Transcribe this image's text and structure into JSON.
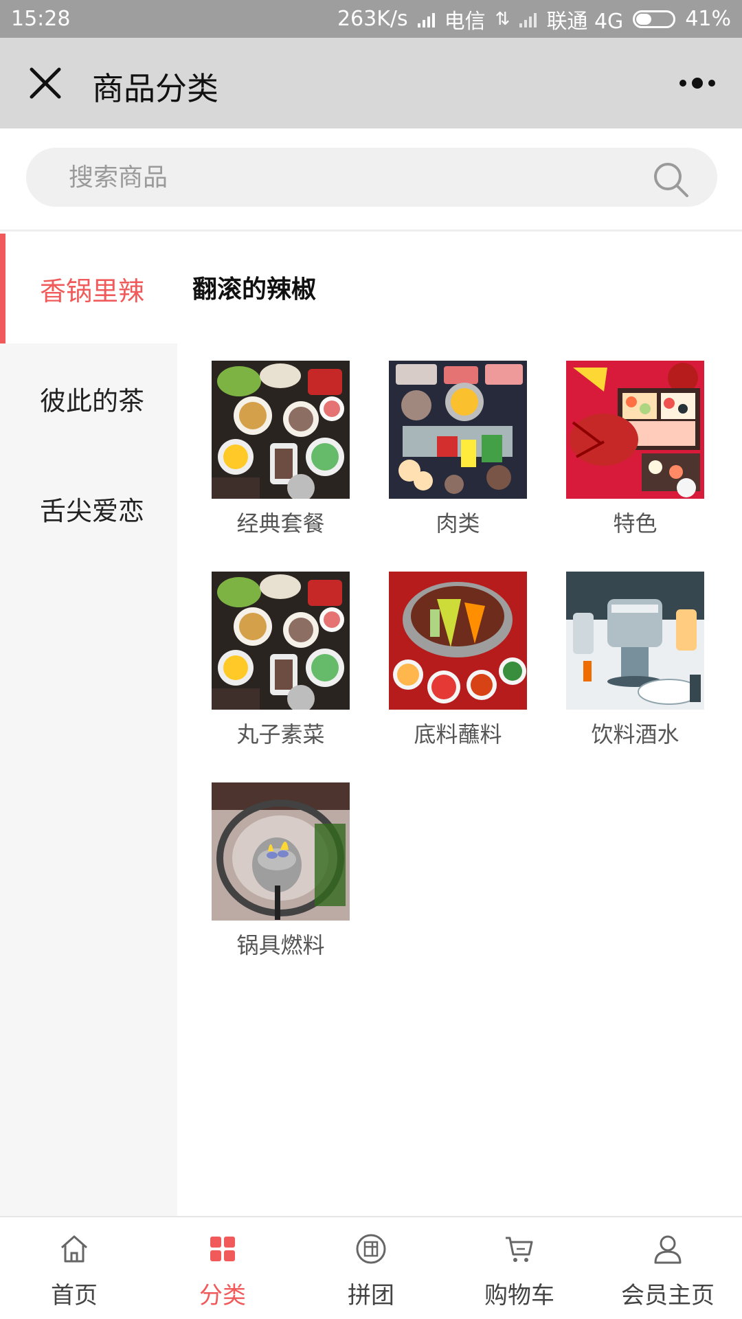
{
  "status_bar": {
    "time": "15:28",
    "speed": "263K/s",
    "carrier1": "电信",
    "carrier2": "联通 4G",
    "battery": "41%",
    "battery_level": 0.41
  },
  "header": {
    "title": "商品分类",
    "close_icon": "close-icon",
    "more_icon": "more-dots-icon"
  },
  "search": {
    "placeholder": "搜索商品",
    "value": "",
    "icon": "search-icon"
  },
  "sidebar": {
    "items": [
      {
        "label": "香锅里辣",
        "active": true
      },
      {
        "label": "彼此的茶",
        "active": false
      },
      {
        "label": "舌尖爱恋",
        "active": false
      }
    ]
  },
  "content": {
    "section_title": "翻滚的辣椒",
    "categories": [
      {
        "label": "经典套餐",
        "image": "hotpot-spread-photo"
      },
      {
        "label": "肉类",
        "image": "meat-platter-photo"
      },
      {
        "label": "特色",
        "image": "lobster-bento-photo"
      },
      {
        "label": "丸子素菜",
        "image": "hotpot-spread-photo"
      },
      {
        "label": "底料蘸料",
        "image": "hotpot-broth-sauces-photo"
      },
      {
        "label": "饮料酒水",
        "image": "steel-pot-table-photo"
      },
      {
        "label": "锅具燃料",
        "image": "burner-flame-photo"
      }
    ]
  },
  "tab_bar": {
    "items": [
      {
        "label": "首页",
        "icon": "home-icon",
        "active": false
      },
      {
        "label": "分类",
        "icon": "category-grid-icon",
        "active": true
      },
      {
        "label": "拼团",
        "icon": "group-buy-icon",
        "active": false
      },
      {
        "label": "购物车",
        "icon": "cart-icon",
        "active": false
      },
      {
        "label": "会员主页",
        "icon": "user-icon",
        "active": false
      }
    ]
  },
  "colors": {
    "accent": "#f05a5a",
    "title_bar": "#d8d8d8",
    "status_bar": "#9e9e9e",
    "sidebar_bg": "#f6f6f6"
  }
}
